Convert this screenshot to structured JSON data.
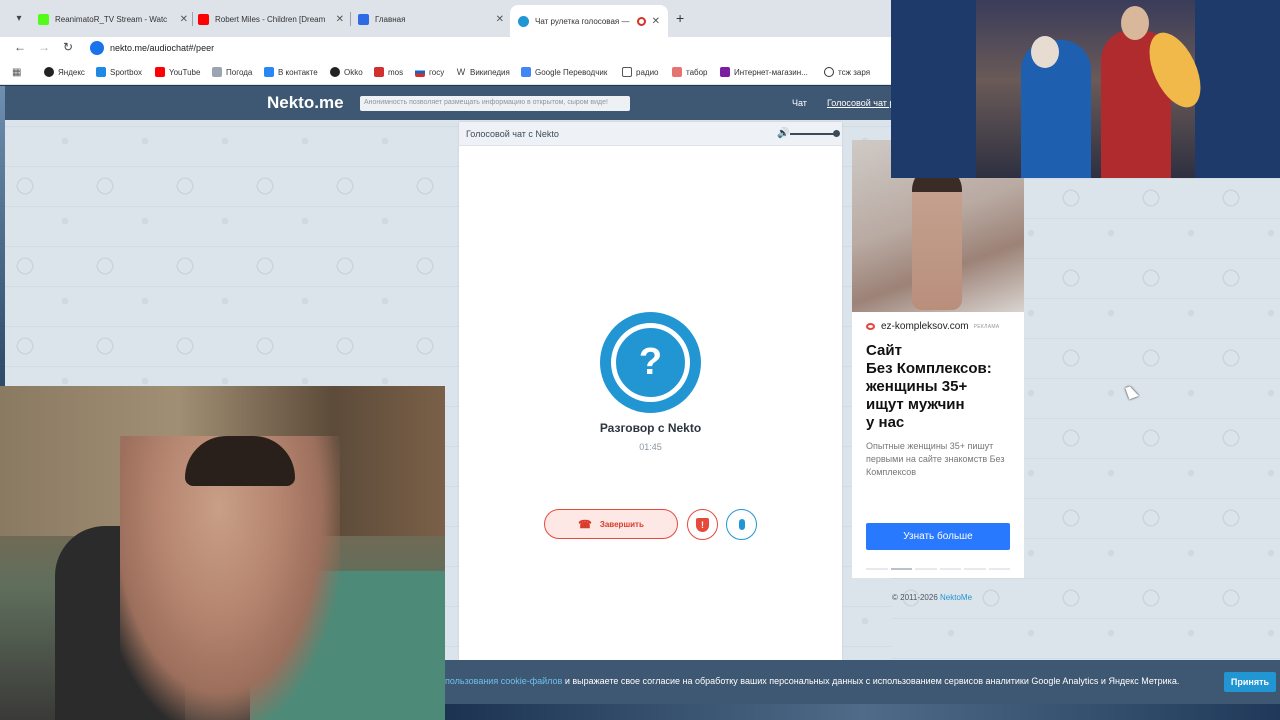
{
  "browser": {
    "tabs": [
      {
        "title": "ReanimatoR_TV Stream - Watc",
        "favicon_color": "#53fc18",
        "active": false
      },
      {
        "title": "Robert Miles - Children [Dream",
        "favicon_color": "#ff0000",
        "active": false
      },
      {
        "title": "Главная",
        "favicon_color": "#2f6ae6",
        "active": false
      },
      {
        "title": "Чат рулетка голосовая —",
        "favicon_color": "#2196d3",
        "active": true
      }
    ],
    "new_tab_label": "+",
    "url": "nekto.me/audiochat#/peer",
    "bookmarks": [
      {
        "label": "Яндекс",
        "icon_color": "#222222"
      },
      {
        "label": "Sportbox",
        "icon_color": "#1e88e5"
      },
      {
        "label": "YouTube",
        "icon_color": "#ff0000"
      },
      {
        "label": "Погода",
        "icon_color": "#9aa5b1"
      },
      {
        "label": "В контакте",
        "icon_color": "#2787f5"
      },
      {
        "label": "Okko",
        "icon_color": "#222222"
      },
      {
        "label": "mos",
        "icon_color": "#d32f2f"
      },
      {
        "label": "госу",
        "icon_color": "#1565c0"
      },
      {
        "label": "Википедия",
        "icon_color": "#444444"
      },
      {
        "label": "Google Переводчик",
        "icon_color": "#4285f4"
      },
      {
        "label": "радио",
        "icon_color": "#555555"
      },
      {
        "label": "табор",
        "icon_color": "#e57373"
      },
      {
        "label": "Интернет-магазин...",
        "icon_color": "#7b1fa2"
      },
      {
        "label": "тсж заря",
        "icon_color": "#333333"
      }
    ]
  },
  "site": {
    "logo": "Nekto.me",
    "notice": "Анонимность позволяет размещать информацию в открытом, сыром виде!",
    "nav": {
      "chat": "Чат",
      "voice": "Голосовой чат р"
    },
    "accent_color": "#2196d3",
    "header_color": "#3e5772"
  },
  "chat": {
    "title": "Голосовой чат с Nekto",
    "volume": 1.0,
    "peer_avatar": "?",
    "peer_name": "Разговор с Nekto",
    "timer": "01:45",
    "end_button": "Завершить",
    "report_icon": "!"
  },
  "ad": {
    "domain": "ez-kompleksov.com",
    "tag": "РЕКЛАМА",
    "headline": [
      "Сайт",
      "Без Комплексов:",
      "женщины 35+",
      "ищут мужчин",
      "у нас"
    ],
    "body": "Опытные женщины 35+ пишут первыми на сайте знакомств Без Комплексов",
    "cta": "Узнать больше",
    "carousel_slides": 6,
    "carousel_active": 2
  },
  "copyright": {
    "text": "© 2011-2026 ",
    "link": "NektoMe"
  },
  "cookie": {
    "link_text": "пользования cookie-файлов",
    "text": " и выражаете свое согласие на обработку ваших персональных данных с использованием сервисов аналитики Google Analytics и Яндекс Метрика.",
    "accept": "Принять"
  }
}
